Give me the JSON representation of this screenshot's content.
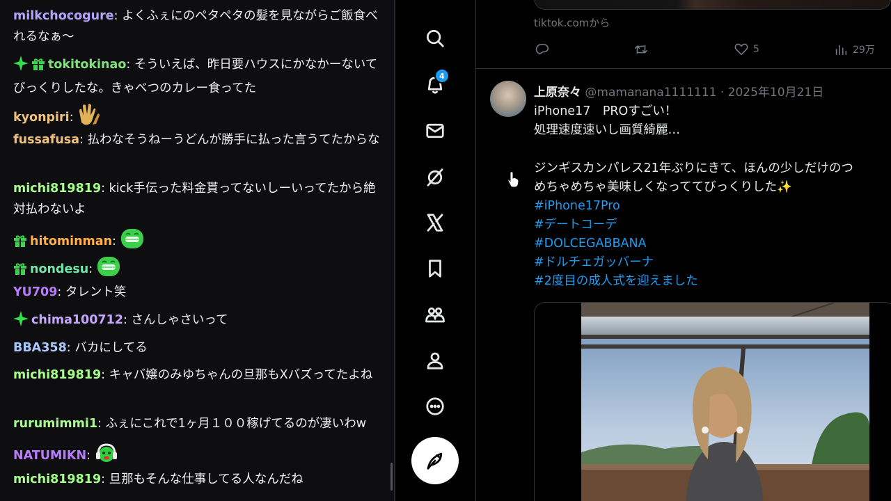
{
  "chat": {
    "messages": [
      {
        "user": "milkchocogure",
        "color": "#b4a3ff",
        "text": "よくふぇにのペタペタの髪を見ながらご飯食べれるなぁ〜",
        "badges": []
      },
      {
        "user": "tokitokinao",
        "color": "#7fe37a",
        "text": "そういえば、昨日要ハウスにかなかーないてびっくりしたな。きゃべつのカレー食ってた",
        "badges": [
          "sparkle-badge-icon",
          "gift-badge-icon"
        ]
      },
      {
        "user": "kyonpiri",
        "color": "#f0c27b",
        "text": "",
        "badges": [],
        "emote": "clapping-hands-emote"
      },
      {
        "user": "fussafusa",
        "color": "#f0c27b",
        "text": "払わなそうねーうどんが勝手に払った言うてたからな",
        "badges": []
      },
      {
        "user": "michi819819",
        "color": "#a5ff8a",
        "text": "kick手伝った料金貰ってないしーいってたから絶対払わないよ",
        "badges": []
      },
      {
        "user": "hitominman",
        "color": "#ffb04a",
        "text": "",
        "badges": [
          "gift-badge-icon"
        ],
        "emote": "grin-emote"
      },
      {
        "user": "nondesu",
        "color": "#6ee7a8",
        "text": "",
        "badges": [
          "gift-badge-icon"
        ],
        "emote": "grin-emote"
      },
      {
        "user": "YU709",
        "color": "#b97cff",
        "text": "タレント笑",
        "badges": []
      },
      {
        "user": "chima100712",
        "color": "#c7a6ff",
        "text": "さんしゃさいって",
        "badges": [
          "sparkle-badge-icon"
        ]
      },
      {
        "user": "BBA358",
        "color": "#a9c6ff",
        "text": "バカにしてる",
        "badges": []
      },
      {
        "user": "michi819819",
        "color": "#a5ff8a",
        "text": "キャバ嬢のみゆちゃんの旦那もXバズってたよね",
        "badges": []
      },
      {
        "user": "rurumimmi1",
        "color": "#a5ff8a",
        "text": "ふぇにこれで1ヶ月１００稼げてるのが凄いわw",
        "badges": []
      },
      {
        "user": "NATUMIKN",
        "color": "#b97cff",
        "text": "",
        "badges": [],
        "emote": "headphone-emote"
      },
      {
        "user": "michi819819",
        "color": "#a5ff8a",
        "text": "旦那もそんな仕事してる人なんだね",
        "badges": []
      }
    ]
  },
  "nav": {
    "notifications_badge": "4",
    "items": [
      "home-icon",
      "search-icon",
      "notifications-icon",
      "messages-icon",
      "grok-icon",
      "x-premium-icon",
      "bookmarks-icon",
      "communities-icon",
      "profile-icon",
      "more-icon"
    ]
  },
  "prev_tweet": {
    "source": "tiktok.comから",
    "likes": "5",
    "views": "29万"
  },
  "tweet": {
    "name": "上原奈々",
    "meta": "@mamanana1111111 · 2025年10月21日",
    "lines": [
      "iPhone17　PROすごい！",
      "処理速度速いし画質綺麗…",
      "",
      "ジンギスカンパレス21年ぶりにきて、ほんの少しだけのつ",
      "めちゃめちゃ美味しくなっててびっくりした✨"
    ],
    "hashtags": [
      "#iPhone17Pro",
      "#デートコーデ",
      "#DOLCEGABBANA",
      "#ドルチェガッバーナ",
      "#2度目の成人式を迎えました"
    ]
  },
  "colors": {
    "accent": "#1d9bf0",
    "chat_bg": "#0e0e10",
    "feed_bg": "#000000"
  }
}
